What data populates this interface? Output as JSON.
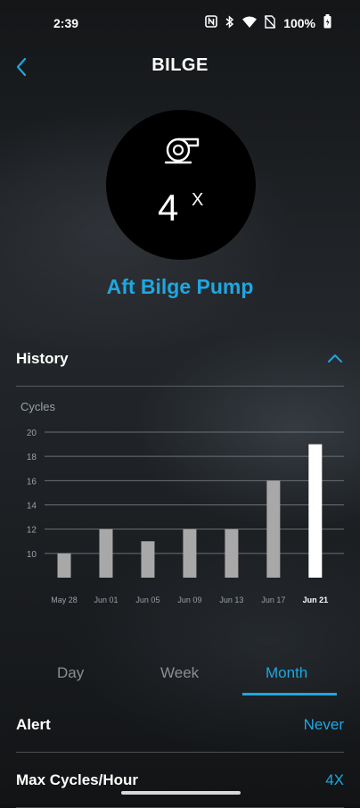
{
  "status_bar": {
    "time": "2:39",
    "battery_percent": "100%",
    "icons": [
      "nfc-icon",
      "bluetooth-icon",
      "wifi-icon",
      "no-sim-icon",
      "battery-charging-icon"
    ]
  },
  "header": {
    "title": "BILGE",
    "back_icon": "chevron-left-icon"
  },
  "counter": {
    "icon": "bilge-pump-icon",
    "value": "4",
    "suffix": "X"
  },
  "device_name": "Aft Bilge Pump",
  "history": {
    "title": "History",
    "toggle_icon": "chevron-up-icon"
  },
  "chart_data": {
    "type": "bar",
    "ylabel": "Cycles",
    "ylim": [
      8,
      20
    ],
    "yticks": [
      10,
      12,
      14,
      16,
      18,
      20
    ],
    "categories": [
      "May 28",
      "Jun 01",
      "Jun 05",
      "Jun 09",
      "Jun 13",
      "Jun 17",
      "Jun 21"
    ],
    "values": [
      10,
      12,
      11,
      12,
      12,
      16,
      19
    ],
    "highlighted_category": "Jun 21",
    "colors": {
      "bar": "#a8a8a8",
      "highlight": "#ffffff",
      "grid": "#6b7075",
      "accent": "#1ea7e1"
    }
  },
  "tabs": [
    {
      "label": "Day",
      "active": false
    },
    {
      "label": "Week",
      "active": false
    },
    {
      "label": "Month",
      "active": true
    }
  ],
  "settings": [
    {
      "label": "Alert",
      "value": "Never"
    },
    {
      "label": "Max Cycles/Hour",
      "value": "4X"
    }
  ]
}
